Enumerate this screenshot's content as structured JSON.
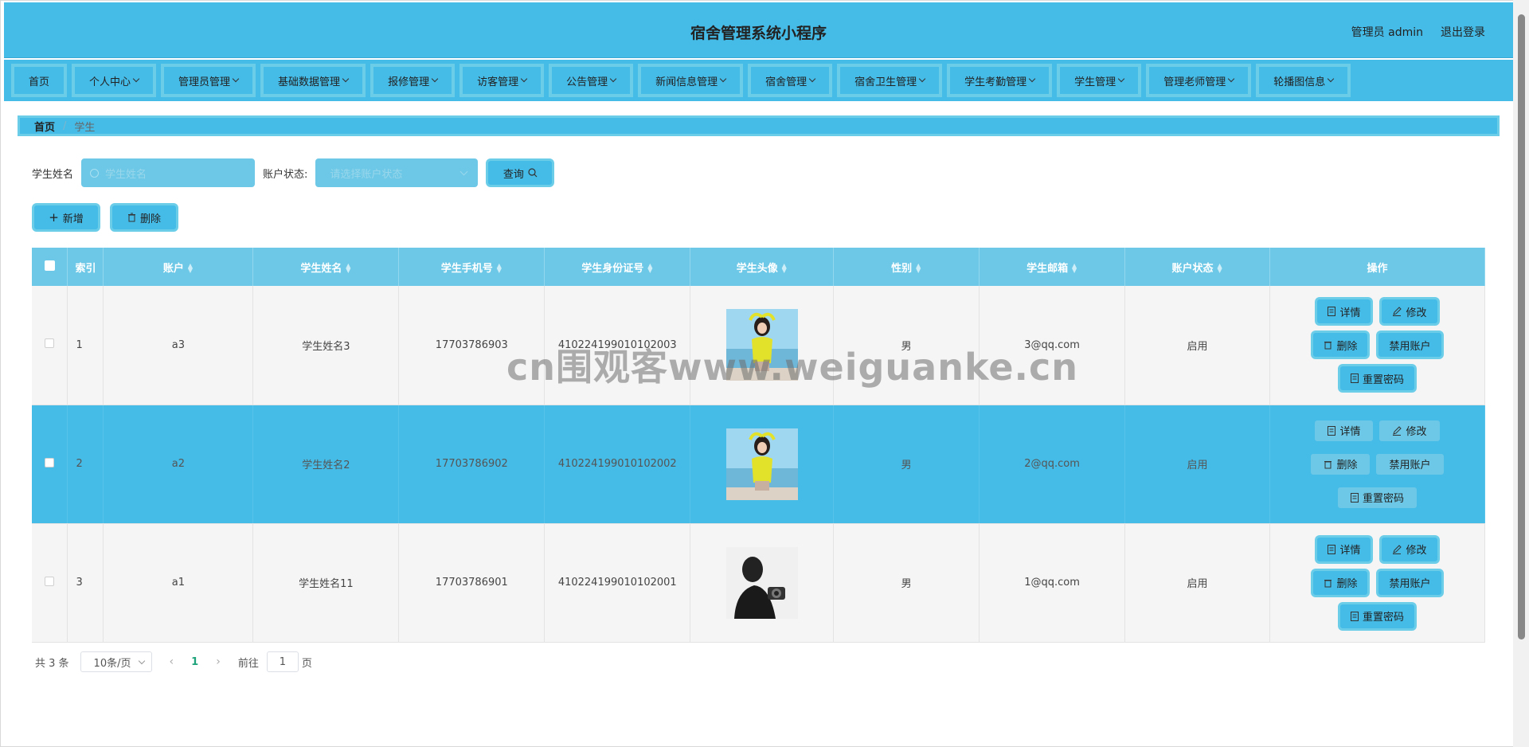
{
  "header": {
    "title": "宿舍管理系统小程序",
    "user": "管理员 admin",
    "logout": "退出登录"
  },
  "nav": [
    {
      "label": "首页",
      "has_menu": false
    },
    {
      "label": "个人中心",
      "has_menu": true
    },
    {
      "label": "管理员管理",
      "has_menu": true
    },
    {
      "label": "基础数据管理",
      "has_menu": true
    },
    {
      "label": "报修管理",
      "has_menu": true
    },
    {
      "label": "访客管理",
      "has_menu": true
    },
    {
      "label": "公告管理",
      "has_menu": true
    },
    {
      "label": "新闻信息管理",
      "has_menu": true
    },
    {
      "label": "宿舍管理",
      "has_menu": true
    },
    {
      "label": "宿舍卫生管理",
      "has_menu": true
    },
    {
      "label": "学生考勤管理",
      "has_menu": true
    },
    {
      "label": "学生管理",
      "has_menu": true
    },
    {
      "label": "管理老师管理",
      "has_menu": true
    },
    {
      "label": "轮播图信息",
      "has_menu": true
    }
  ],
  "breadcrumb": {
    "home": "首页",
    "sep": "/",
    "current": "学生"
  },
  "search": {
    "name_label": "学生姓名",
    "name_placeholder": "学生姓名",
    "status_label": "账户状态:",
    "status_placeholder": "请选择账户状态",
    "query_button": "查询"
  },
  "actions": {
    "add": "新增",
    "delete": "删除"
  },
  "table": {
    "columns": [
      "索引",
      "账户",
      "学生姓名",
      "学生手机号",
      "学生身份证号",
      "学生头像",
      "性别",
      "学生邮箱",
      "账户状态",
      "操作"
    ],
    "rows": [
      {
        "index": "1",
        "account": "a3",
        "name": "学生姓名3",
        "phone": "17703786903",
        "id_card": "410224199010102003",
        "gender": "男",
        "email": "3@qq.com",
        "status": "启用",
        "avatar": "girl-yellow"
      },
      {
        "index": "2",
        "account": "a2",
        "name": "学生姓名2",
        "phone": "17703786902",
        "id_card": "410224199010102002",
        "gender": "男",
        "email": "2@qq.com",
        "status": "启用",
        "avatar": "girl-yellow"
      },
      {
        "index": "3",
        "account": "a1",
        "name": "学生姓名11",
        "phone": "17703786901",
        "id_card": "410224199010102001",
        "gender": "男",
        "email": "1@qq.com",
        "status": "启用",
        "avatar": "man-camera"
      }
    ],
    "ops": {
      "detail": "详情",
      "edit": "修改",
      "delete": "删除",
      "disable": "禁用账户",
      "reset": "重置密码"
    }
  },
  "pager": {
    "total": "共 3 条",
    "page_size": "10条/页",
    "current_page": "1",
    "goto_prefix": "前往",
    "goto_value": "1",
    "goto_suffix": "页"
  },
  "watermark": "cn围观客www.weiguanke.cn",
  "colors": {
    "primary": "#45bbe7",
    "light": "#6cc8e6",
    "border": "#6ccde9"
  }
}
